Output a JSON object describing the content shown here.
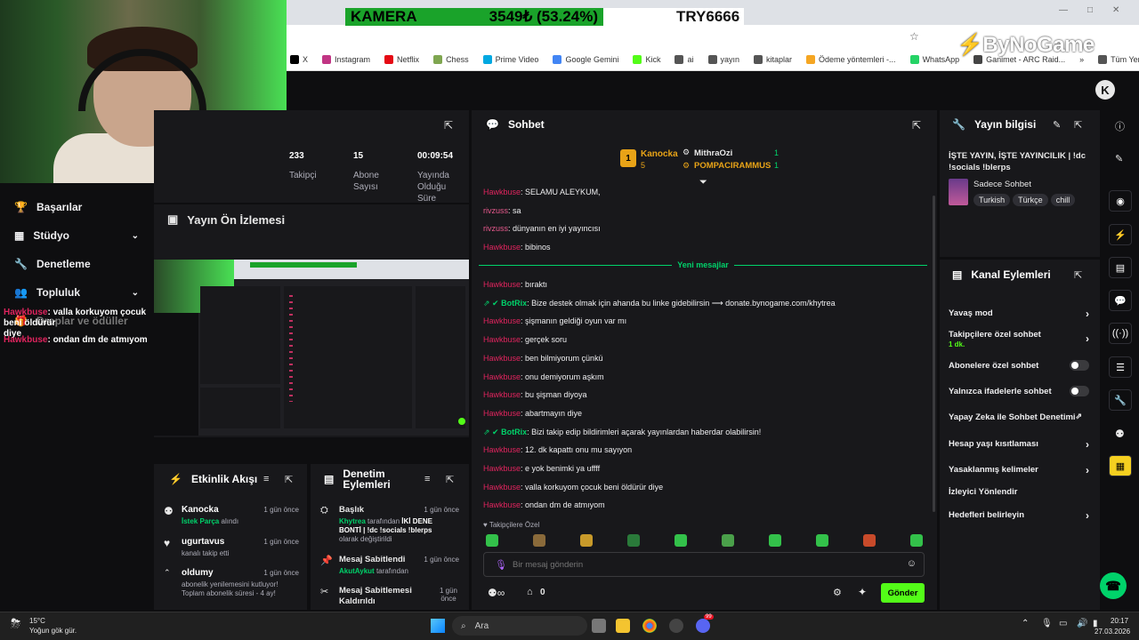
{
  "browser": {
    "kamera_label": "KAMERA",
    "kamera_value": "3549₺ (53.24%)",
    "try_label": "TRY6666",
    "brand": "ByNoGame",
    "bookmarks": [
      "X",
      "Instagram",
      "Netflix",
      "Chess",
      "Prime Video",
      "Google Gemini",
      "Kick",
      "ai",
      "yayın",
      "kitaplar",
      "Ödeme yöntemleri -...",
      "WhatsApp",
      "Ganimet - ARC Raid...",
      "»",
      "Tüm Yer İşaretleri"
    ],
    "bookmark_colors": [
      "#000000",
      "#c13584",
      "#e50914",
      "#7fa650",
      "#00a8e1",
      "#4285f4",
      "#53fc18",
      "#555555",
      "#555555",
      "#555555",
      "#f5a623",
      "#25d366",
      "#444444",
      "#555555",
      "#555555"
    ]
  },
  "sidebar": {
    "items": [
      {
        "label": "Başarılar",
        "icon": "trophy-icon"
      },
      {
        "label": "Stüdyo",
        "icon": "studio-icon",
        "chevron": true
      },
      {
        "label": "Denetleme",
        "icon": "wrench-icon"
      },
      {
        "label": "Topluluk",
        "icon": "community-icon",
        "chevron": true
      },
      {
        "label": "Droplar ve ödüller",
        "icon": "gift-icon"
      }
    ],
    "overlay_chat": [
      {
        "user": "Hawkbuse",
        "text": ": valla korkuyom çocuk beni öldürür",
        "cont": "diye"
      },
      {
        "user": "Hawkbuse",
        "text": ": ondan dm de atmıyom",
        "cont": ""
      }
    ]
  },
  "stats": {
    "items": [
      {
        "value": "233",
        "label": "Takipçi"
      },
      {
        "value": "15",
        "label": "Abone Sayısı"
      },
      {
        "value": "00:09:54",
        "label": "Yayında Olduğu Süre"
      }
    ]
  },
  "preview": {
    "title": "Yayın Ön İzlemesi"
  },
  "activity": {
    "title": "Etkinlik Akışı",
    "rows": [
      {
        "name": "Kanocka",
        "sub_green": "İstek Parça",
        "sub": " alındı",
        "time": "1 gün önce"
      },
      {
        "name": "ugurtavus",
        "sub_green": "",
        "sub": "kanalı takip etti",
        "time": "1 gün önce"
      },
      {
        "name": "oldumy",
        "sub_green": "",
        "sub": "abonelik yenilemesini kutluyor! Toplam abonelik süresi - 4 ay!",
        "time": "1 gün önce"
      }
    ]
  },
  "mod_actions": {
    "title": "Denetim Eylemleri",
    "rows": [
      {
        "name": "Başlık",
        "actor": "Khytrea",
        "sub": " tarafından ",
        "bold": "İKİ DENE BONTİ | !dc !socials !blerps",
        "tail": " olarak değiştirildi",
        "time": "1 gün önce"
      },
      {
        "name": "Mesaj Sabitlendi",
        "actor": "AkutAykut",
        "sub": " tarafından",
        "bold": "",
        "tail": "",
        "time": "1 gün önce"
      },
      {
        "name": "Mesaj Sabitlemesi Kaldırıldı",
        "actor": "",
        "sub": "",
        "bold": "",
        "tail": "",
        "time": "1 gün önce"
      }
    ]
  },
  "chat": {
    "title": "Sohbet",
    "leaders": [
      {
        "name": "Kanocka",
        "count": "5"
      },
      {
        "name": "MithraOzi",
        "count": "1"
      },
      {
        "name": "POMPACIRAMMUS",
        "count": "1"
      }
    ],
    "rank_badge": "1",
    "new_messages": "Yeni mesajlar",
    "messages_before": [
      {
        "user": "Hawkbuse",
        "text": ": SELAMU ALEYKUM,"
      },
      {
        "user": "rivzuss",
        "text": ": sa"
      },
      {
        "user": "rivzuss",
        "text": ": dünyanın en iyi yayıncısı"
      },
      {
        "user": "Hawkbuse",
        "text": ": bibinos"
      }
    ],
    "messages_after": [
      {
        "user": "Hawkbuse",
        "text": ": bıraktı",
        "bot": false
      },
      {
        "user": "BotRix",
        "text": ": Bize destek olmak için ahanda bu linke gidebilirsin ⟶ donate.bynogame.com/khytrea",
        "bot": true
      },
      {
        "user": "Hawkbuse",
        "text": ": şişmanın geldiği oyun var mı",
        "bot": false
      },
      {
        "user": "Hawkbuse",
        "text": ": gerçek soru",
        "bot": false
      },
      {
        "user": "Hawkbuse",
        "text": ": ben bilmiyorum çünkü",
        "bot": false
      },
      {
        "user": "Hawkbuse",
        "text": ": onu demiyorum aşkım",
        "bot": false
      },
      {
        "user": "Hawkbuse",
        "text": ": bu şişman diyoya",
        "bot": false
      },
      {
        "user": "Hawkbuse",
        "text": ": abartmayın diye",
        "bot": false
      },
      {
        "user": "BotRix",
        "text": ": Bizi takip edip bildirimleri açarak yayınlardan haberdar olabilirsin!",
        "bot": true
      },
      {
        "user": "Hawkbuse",
        "text": ": 12. dk kapattı onu mu sayıyon",
        "bot": false
      },
      {
        "user": "Hawkbuse",
        "text": ": e yok benimki ya uffff",
        "bot": false
      },
      {
        "user": "Hawkbuse",
        "text": ": valla korkuyom çocuk beni öldürür diye",
        "bot": false
      },
      {
        "user": "Hawkbuse",
        "text": ": ondan dm de atmıyom",
        "bot": false
      }
    ],
    "follower_only": "Takipçilere Özel",
    "input_placeholder": "Bir mesaj gönderin",
    "points": "0",
    "send_label": "Gönder"
  },
  "stream_info": {
    "title": "Yayın bilgisi",
    "stream_title": "İŞTE YAYIN, İŞTE YAYINCILIK | !dc !socials !blerps",
    "category": "Sadece Sohbet",
    "tags": [
      "Turkish",
      "Türkçe",
      "chill"
    ]
  },
  "channel_actions": {
    "title": "Kanal Eylemleri",
    "items": [
      {
        "label": "Yavaş mod",
        "type": "chevron"
      },
      {
        "label": "Takipçilere özel sohbet",
        "sub": "1 dk.",
        "type": "chevron"
      },
      {
        "label": "Abonelere özel sohbet",
        "type": "toggle"
      },
      {
        "label": "Yalnızca ifadelerle sohbet",
        "type": "toggle"
      },
      {
        "label": "Yapay Zeka ile Sohbet Denetimi",
        "type": "external"
      },
      {
        "label": "Hesap yaşı kısıtlaması",
        "type": "chevron"
      },
      {
        "label": "Yasaklanmış kelimeler",
        "type": "chevron"
      },
      {
        "label": "İzleyici Yönlendir",
        "type": "none"
      },
      {
        "label": "Hedefleri belirleyin",
        "type": "chevron"
      }
    ]
  },
  "taskbar": {
    "weather_temp": "15°C",
    "weather_desc": "Yoğun gök gür.",
    "search_label": "Ara",
    "time": "20:17",
    "date": "27.03.2026",
    "discord_badge": "99"
  },
  "colors": {
    "accent": "#53fc18",
    "username": "#e0245e",
    "bot": "#00d26a",
    "bg": "#0e0e10",
    "panel": "#18181b"
  }
}
